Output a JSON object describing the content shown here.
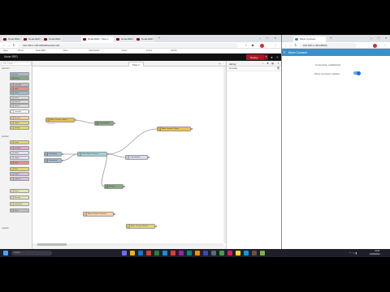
{
  "browser1": {
    "tabs": [
      {
        "label": "Node-RED",
        "active": false
      },
      {
        "label": "Node-RED",
        "active": false
      },
      {
        "label": "Node-RED",
        "active": false
      },
      {
        "label": "Node-RED : Flow 1",
        "active": true
      },
      {
        "label": "Node-RED",
        "active": false
      },
      {
        "label": "Node-RED",
        "active": false
      }
    ],
    "url": "192.168.1.100:1880/#flow/abc123",
    "bookmarks": [
      "Apps",
      "Home",
      "Node-RED",
      "Docs",
      "Dashboard",
      "Flows",
      "Forum",
      "GitHub"
    ]
  },
  "nodered": {
    "logo": "Node-RED",
    "deploy_label": "Deploy",
    "flow_tab": "Flow 1",
    "palette": {
      "filter_placeholder": "filter nodes",
      "categories": [
        "common",
        "function",
        "network"
      ],
      "nodes": [
        {
          "label": "inject",
          "color": "#a6bbcf"
        },
        {
          "label": "debug",
          "color": "#87a980"
        },
        {
          "label": "complete",
          "color": "#c0c0c0"
        },
        {
          "label": "catch",
          "color": "#e49191"
        },
        {
          "label": "status",
          "color": "#94c1d0"
        },
        {
          "label": "link in",
          "color": "#dddddd"
        },
        {
          "label": "link call",
          "color": "#dddddd"
        },
        {
          "label": "link out",
          "color": "#dddddd"
        },
        {
          "label": "comment",
          "color": "#ffffff"
        },
        {
          "label": "function",
          "color": "#fdd0a2"
        },
        {
          "label": "switch",
          "color": "#e2d96e"
        },
        {
          "label": "change",
          "color": "#e2d96e"
        },
        {
          "label": "range",
          "color": "#e2d96e"
        },
        {
          "label": "template",
          "color": "#e7a8d0"
        },
        {
          "label": "delay",
          "color": "#e6e0f8"
        },
        {
          "label": "trigger",
          "color": "#e6e0f8"
        },
        {
          "label": "exec",
          "color": "#e49191"
        },
        {
          "label": "filter",
          "color": "#e2d96e"
        },
        {
          "label": "mqtt in",
          "color": "#d8bfd8"
        },
        {
          "label": "mqtt out",
          "color": "#d8bfd8"
        },
        {
          "label": "http in",
          "color": "#e7e7ae"
        },
        {
          "label": "http req",
          "color": "#e7e7ae"
        },
        {
          "label": "websocket",
          "color": "#e7e7ae"
        },
        {
          "label": "tcp in",
          "color": "#c0c0c0"
        }
      ]
    },
    "flow_nodes": [
      {
        "label": "Move Connect Status",
        "color": "#e8c14d"
      },
      {
        "label": "msg.payload",
        "color": "#87a980"
      },
      {
        "label": "timestamp",
        "color": "#a6bbcf"
      },
      {
        "label": "timestamp",
        "color": "#a6bbcf"
      },
      {
        "label": "Parse Move Connect",
        "color": "#9fd4d8"
      },
      {
        "label": "msg.payload",
        "color": "#dcdcf0"
      },
      {
        "label": "Move Connect Output",
        "color": "#e8c14d"
      },
      {
        "label": "debug 1",
        "color": "#87a980"
      },
      {
        "label": "Move Connect Function",
        "color": "#fdd0a2"
      },
      {
        "label": "Move Connect Switch",
        "color": "#e2d96e"
      }
    ],
    "status_text": "connected",
    "sidebar": {
      "title": "debug",
      "filter": "all nodes"
    }
  },
  "browser2": {
    "tabs": [
      {
        "label": "Move Connect",
        "active": true
      }
    ],
    "url": "192.168.1.100:1880/ui",
    "app_title": "Move Connect",
    "status_label": "Connection established",
    "toggle_label": "Move Connect enabled",
    "toggle_on": true
  },
  "taskbar": {
    "search_placeholder": "Search",
    "time": "12:41",
    "date": "01/05/2024"
  }
}
